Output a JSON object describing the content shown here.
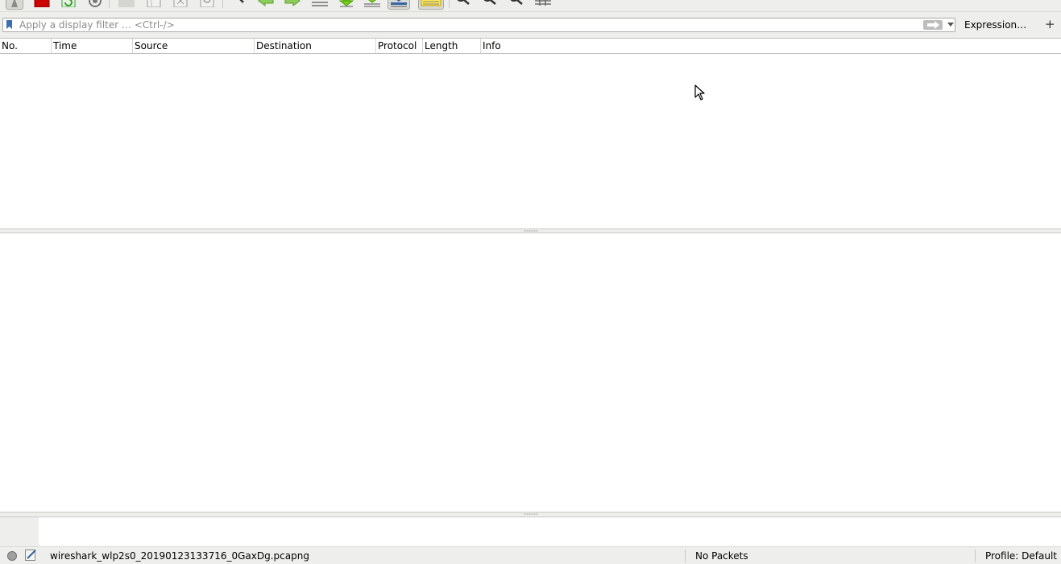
{
  "toolbar": {
    "buttons": [
      {
        "name": "start-capture-icon",
        "color": "#8a8a8a"
      },
      {
        "name": "stop-capture-icon",
        "color": "#cc0000"
      },
      {
        "name": "restart-capture-icon",
        "color": "#3a9b3a"
      },
      {
        "name": "capture-options-icon",
        "color": "#777777"
      },
      {
        "name": "open-file-icon",
        "color": "#9a9a9a"
      },
      {
        "name": "save-file-icon",
        "color": "#9a9a9a"
      },
      {
        "name": "close-file-icon",
        "color": "#9a9a9a"
      },
      {
        "name": "reload-file-icon",
        "color": "#9a9a9a"
      },
      {
        "name": "find-packet-icon",
        "color": "#333333"
      },
      {
        "name": "go-back-icon",
        "color": "#5aa02c"
      },
      {
        "name": "go-forward-icon",
        "color": "#5aa02c"
      },
      {
        "name": "go-to-packet-icon",
        "color": "#555555"
      },
      {
        "name": "first-packet-icon",
        "color": "#4e9a06"
      },
      {
        "name": "last-packet-icon",
        "color": "#4e9a06"
      },
      {
        "name": "auto-scroll-icon",
        "color": "#3465a4"
      },
      {
        "name": "colorize-icon",
        "color": "#c4a000"
      },
      {
        "name": "zoom-in-icon",
        "color": "#333333"
      },
      {
        "name": "zoom-out-icon",
        "color": "#333333"
      },
      {
        "name": "normal-size-icon",
        "color": "#333333"
      },
      {
        "name": "resize-columns-icon",
        "color": "#555555"
      }
    ]
  },
  "filter": {
    "placeholder": "Apply a display filter … <Ctrl-/>",
    "expression_label": "Expression…",
    "add_label": "+"
  },
  "packet_list": {
    "columns": [
      "No.",
      "Time",
      "Source",
      "Destination",
      "Protocol",
      "Length",
      "Info"
    ]
  },
  "status": {
    "filename": "wireshark_wlp2s0_20190123133716_0GaxDg.pcapng",
    "packets": "No Packets",
    "profile": "Profile: Default"
  }
}
